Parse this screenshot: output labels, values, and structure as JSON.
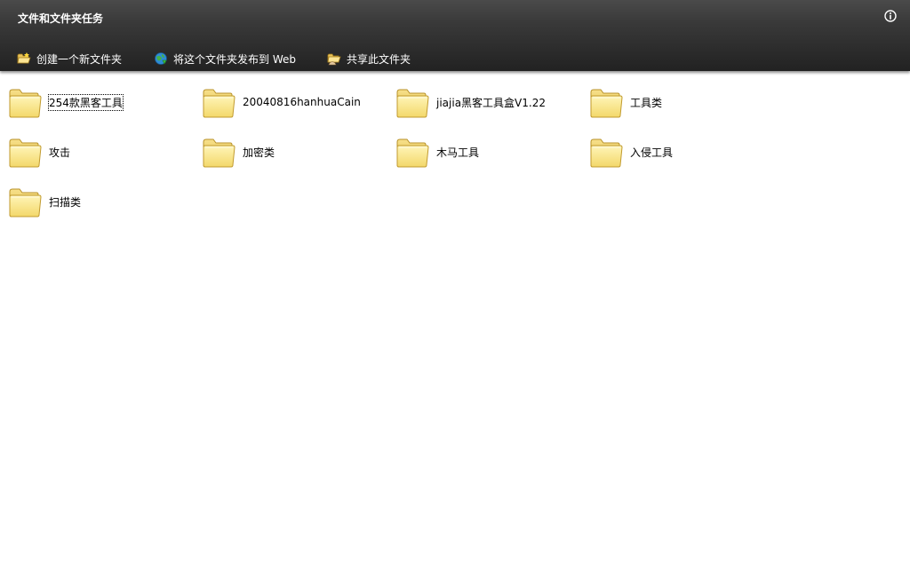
{
  "task_pane": {
    "title": "文件和文件夹任务",
    "tasks": [
      {
        "label": "创建一个新文件夹",
        "icon": "new-folder-icon"
      },
      {
        "label": "将这个文件夹发布到 Web",
        "icon": "publish-web-icon"
      },
      {
        "label": "共享此文件夹",
        "icon": "share-folder-icon"
      }
    ]
  },
  "folders": [
    {
      "name": "254款黑客工具",
      "selected": true
    },
    {
      "name": "20040816hanhuaCain"
    },
    {
      "name": "jiajia黑客工具盒V1.22"
    },
    {
      "name": "工具类"
    },
    {
      "name": "攻击"
    },
    {
      "name": "加密类"
    },
    {
      "name": "木马工具"
    },
    {
      "name": "入侵工具"
    },
    {
      "name": "扫描类"
    }
  ]
}
